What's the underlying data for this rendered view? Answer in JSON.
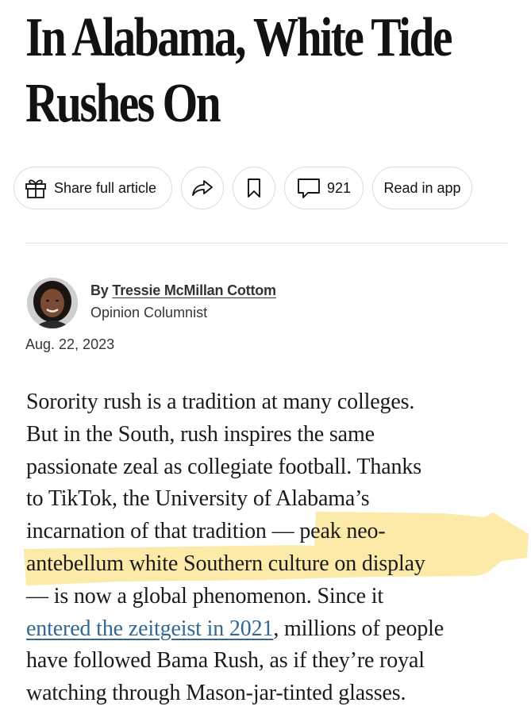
{
  "article": {
    "headline_lines": [
      "In Alabama, White Tide",
      "Rushes On"
    ]
  },
  "toolbar": {
    "share_full_label": "Share full article",
    "comment_count": "921",
    "read_in_app_label": "Read in app",
    "icons": {
      "gift": "gift-icon",
      "share": "share-arrow-icon",
      "save": "bookmark-icon",
      "comments": "comment-bubble-icon"
    }
  },
  "byline": {
    "prefix": "By ",
    "author": "Tressie McMillan Cottom",
    "role": "Opinion Columnist",
    "date": "Aug. 22, 2023"
  },
  "body": {
    "lines": [
      "Sorority rush is a tradition at many colleges.",
      "But in the South, rush inspires the same",
      "passionate zeal as collegiate football. Thanks",
      "to TikTok, the University of Alabama’s",
      "incarnation of that tradition — peak neo-",
      "antebellum white Southern culture on display",
      "— is now a global phenomenon. Since it"
    ],
    "link_text": "entered the zeitgeist in 2021",
    "after_link": ", millions of people",
    "lines_after": [
      "have followed Bama Rush, as if they’re royal",
      "watching through Mason-jar-tinted glasses."
    ]
  },
  "colors": {
    "link": "#326891",
    "highlight": "#fbe9a3",
    "text": "#121212"
  }
}
